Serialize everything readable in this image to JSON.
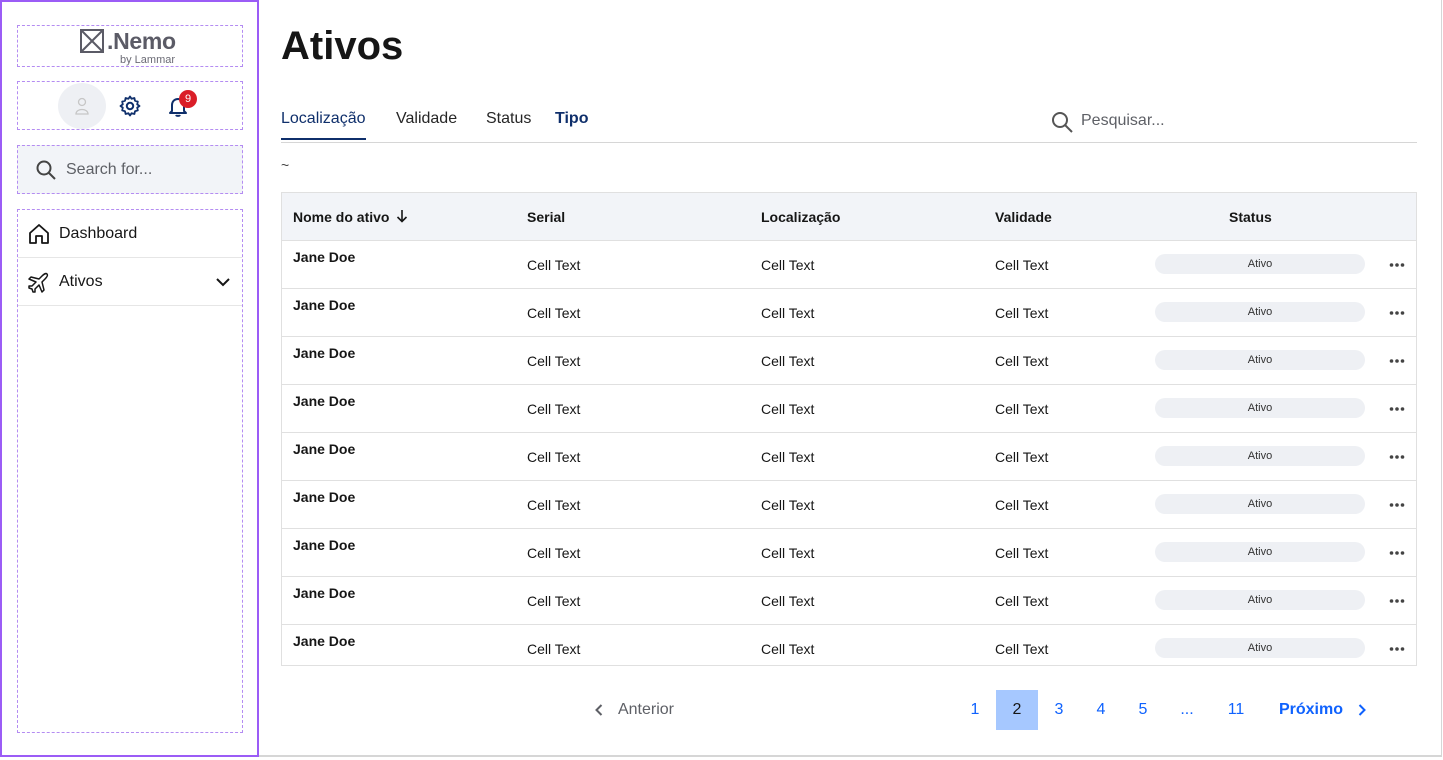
{
  "logo": {
    "name": ".Nemo",
    "sub": "by Lammar"
  },
  "sidebar": {
    "notifications_count": "9",
    "search_placeholder": "Search for...",
    "items": [
      {
        "label": "Dashboard"
      },
      {
        "label": "Ativos"
      }
    ]
  },
  "main": {
    "title": "Ativos",
    "tabs": [
      {
        "label": "Localização"
      },
      {
        "label": "Validade"
      },
      {
        "label": "Status"
      },
      {
        "label": "Tipo"
      }
    ],
    "search_placeholder": "Pesquisar...",
    "tilde": "~"
  },
  "table": {
    "headers": [
      "Nome do ativo",
      "Serial",
      "Localização",
      "Validade",
      "Status"
    ],
    "rows": [
      {
        "name": "Jane Doe",
        "serial": "Cell Text",
        "location": "Cell Text",
        "validity": "Cell Text",
        "status": "Ativo"
      },
      {
        "name": "Jane Doe",
        "serial": "Cell Text",
        "location": "Cell Text",
        "validity": "Cell Text",
        "status": "Ativo"
      },
      {
        "name": "Jane Doe",
        "serial": "Cell Text",
        "location": "Cell Text",
        "validity": "Cell Text",
        "status": "Ativo"
      },
      {
        "name": "Jane Doe",
        "serial": "Cell Text",
        "location": "Cell Text",
        "validity": "Cell Text",
        "status": "Ativo"
      },
      {
        "name": "Jane Doe",
        "serial": "Cell Text",
        "location": "Cell Text",
        "validity": "Cell Text",
        "status": "Ativo"
      },
      {
        "name": "Jane Doe",
        "serial": "Cell Text",
        "location": "Cell Text",
        "validity": "Cell Text",
        "status": "Ativo"
      },
      {
        "name": "Jane Doe",
        "serial": "Cell Text",
        "location": "Cell Text",
        "validity": "Cell Text",
        "status": "Ativo"
      },
      {
        "name": "Jane Doe",
        "serial": "Cell Text",
        "location": "Cell Text",
        "validity": "Cell Text",
        "status": "Ativo"
      },
      {
        "name": "Jane Doe",
        "serial": "Cell Text",
        "location": "Cell Text",
        "validity": "Cell Text",
        "status": "Ativo"
      }
    ]
  },
  "pagination": {
    "prev_label": "Anterior",
    "next_label": "Próximo",
    "pages": [
      "1",
      "2",
      "3",
      "4",
      "5",
      "...",
      "11"
    ],
    "current_page": "2"
  },
  "colors": {
    "sidebar_border": "#9b5cf6",
    "active_tab": "#0f2f6b",
    "link": "#0f62fe",
    "current_page_bg": "#a6c8ff",
    "badge": "#da1e28"
  }
}
